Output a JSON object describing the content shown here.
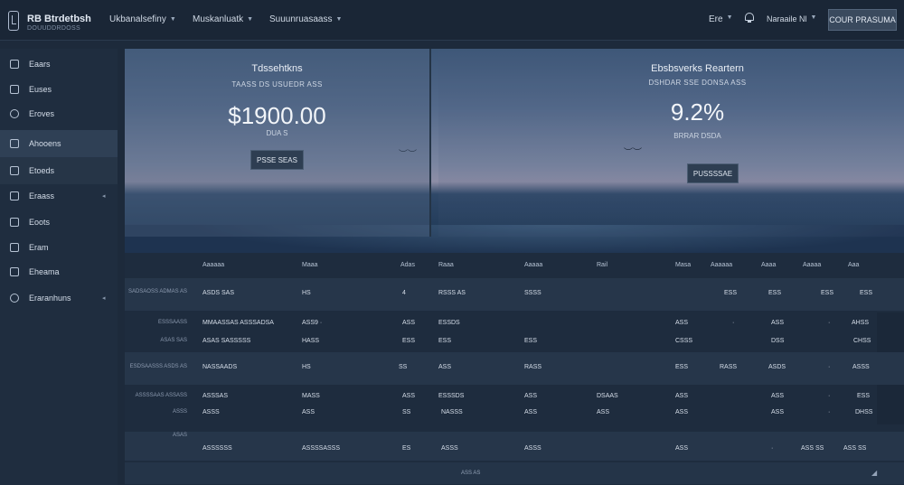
{
  "header": {
    "brand_name": "RB Btrdetbsh",
    "brand_sub": "DOUUDDRDOSS",
    "menu": [
      {
        "label": "Ukbanalsefiny"
      },
      {
        "label": "Muskanluatk"
      },
      {
        "label": "Suuunruasaass"
      }
    ],
    "language": "Ere",
    "account": "Naraaile Nl",
    "cta_label": "COUR PRASUMA"
  },
  "sidebar": {
    "items": [
      {
        "label": "Eaars"
      },
      {
        "label": "Euses"
      },
      {
        "label": "Eroves"
      },
      {
        "label": "Ahooens"
      },
      {
        "label": "Etoeds"
      },
      {
        "label": "Eraass"
      },
      {
        "label": "Eoots"
      },
      {
        "label": "Eram"
      },
      {
        "label": "Eheama"
      },
      {
        "label": "Eraranhuns"
      }
    ]
  },
  "hero": {
    "card1": {
      "title": "Tdssehtkns",
      "subtitle": "TAASS DS USUEDR ASS",
      "amount": "$1900.00",
      "caption": "DUA S",
      "button": "PSSE SEAS"
    },
    "card2": {
      "title": "Ebsbsverks Reartern",
      "subtitle": "DSHDAR SSE DONSA ASS",
      "value": "9.2%",
      "caption": "BRRAR DSDA",
      "button": "PUSSSSAE"
    }
  },
  "table": {
    "headers": [
      "Aaaaaa",
      "Maaa",
      "Adas",
      "Raaa",
      "Aaaaa",
      "Rail",
      "Masa",
      "Aaaaaa",
      "Aaaa",
      "Aaaaa",
      "Aaa"
    ],
    "rows": [
      {
        "group": "SADSAOSS ADMAS AS",
        "cells": [
          "ASDS SAS",
          "HS",
          "4",
          "RSSS AS",
          "SSSS",
          "",
          "",
          "ESS",
          "ESS",
          "ESS",
          "ESS"
        ]
      },
      {
        "group": "ESSSAASS",
        "cells": [
          "MMAASSAS ASSSADSA",
          "ASS9 ·",
          "ASS",
          "ESSDS",
          "",
          "",
          "ASS",
          "·",
          "ASS",
          "·",
          "AHSS"
        ]
      },
      {
        "group": "ASAS SAS",
        "cells": [
          "ASAS SASSSSS",
          "HASS",
          "ESS",
          "ESS",
          "ESS",
          "",
          "CSSS",
          "",
          "DSS",
          "",
          "CHSS"
        ]
      },
      {
        "group": "ESDSAASSS ASDS AS",
        "cells": [
          "NASSAADS",
          "HS",
          "SS",
          "ASS",
          "RASS",
          "",
          "ESS",
          "RASS",
          "ASDS",
          "·",
          "ASSS"
        ]
      },
      {
        "group": "ASSSSAAS ASSASS",
        "cells": [
          "ASSSAS",
          "MASS",
          "ASS",
          "ESSSDS",
          "ASS",
          "DSAAS",
          "ASS",
          "",
          "ASS",
          "·",
          "ESS"
        ]
      },
      {
        "group": "ASSS",
        "cells": [
          "ASSS",
          "ASS",
          "SS",
          "NASSS",
          "ASS",
          "ASS",
          "ASS",
          "",
          "ASS",
          "·",
          "DHSS"
        ]
      },
      {
        "group": "ASAS",
        "cells": [
          "ASSSSSS",
          "ASSSSASSS",
          "ES",
          "ASSS",
          "ASSS",
          "",
          "ASS",
          "",
          "·",
          "ASS SS",
          "ASS SS"
        ]
      }
    ],
    "footer": "ASS AS"
  },
  "colors": {
    "background": "#1d2a3b",
    "topbar": "#1a2636",
    "sidebar": "#1f2d3f",
    "sidebar_active": "#2f4055",
    "accent_button": "#3a4a5e"
  }
}
